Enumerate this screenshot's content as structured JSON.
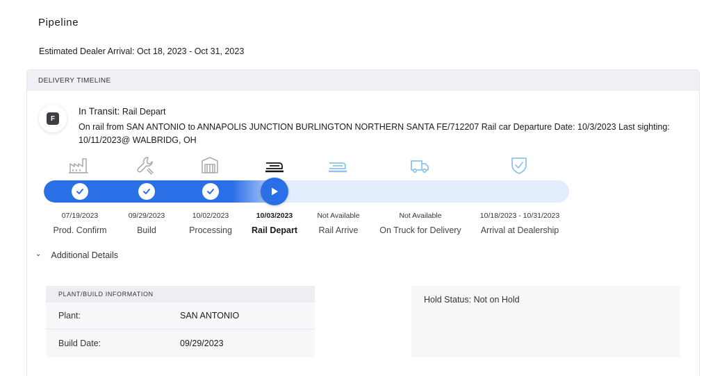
{
  "page": {
    "title": "Pipeline",
    "eta": "Estimated Dealer Arrival: Oct 18, 2023 - Oct 31, 2023"
  },
  "timeline": {
    "header": "DELIVERY TIMELINE",
    "badge_letter": "F",
    "status_label": "In Transit:",
    "status_value": "Rail Depart",
    "status_description": "On rail from SAN ANTONIO to ANNAPOLIS JUNCTION BURLINGTON NORTHERN SANTA FE/712207 Rail car Departure Date: 10/3/2023 Last sighting: 10/11/2023@ WALBRIDG, OH",
    "progress_fraction": 0.46,
    "steps": [
      {
        "label": "Prod. Confirm",
        "date": "07/19/2023",
        "state": "complete",
        "icon": "factory-icon"
      },
      {
        "label": "Build",
        "date": "09/29/2023",
        "state": "complete",
        "icon": "wrench-icon"
      },
      {
        "label": "Processing",
        "date": "10/02/2023",
        "state": "complete",
        "icon": "processing-icon"
      },
      {
        "label": "Rail Depart",
        "date": "10/03/2023",
        "state": "current",
        "icon": "rail-depart-icon"
      },
      {
        "label": "Rail Arrive",
        "date": "Not Available",
        "state": "pending",
        "icon": "rail-arrive-icon"
      },
      {
        "label": "On Truck for Delivery",
        "date": "Not Available",
        "state": "pending",
        "icon": "truck-icon"
      },
      {
        "label": "Arrival at Dealership",
        "date": "10/18/2023 - 10/31/2023",
        "state": "pending",
        "icon": "shield-check-icon"
      }
    ]
  },
  "details": {
    "toggle_label": "Additional Details",
    "plant_header": "PLANT/BUILD INFORMATION",
    "rows": [
      {
        "label": "Plant:",
        "value": "SAN ANTONIO"
      },
      {
        "label": "Build Date:",
        "value": "09/29/2023"
      }
    ],
    "hold_status": "Hold Status: Not on Hold"
  },
  "colors": {
    "accent": "#2b6fe6",
    "track": "#e4edfd",
    "complete_icon": "#a8acb3",
    "current_icon": "#111111",
    "pending_icon": "#8fc3ea"
  }
}
